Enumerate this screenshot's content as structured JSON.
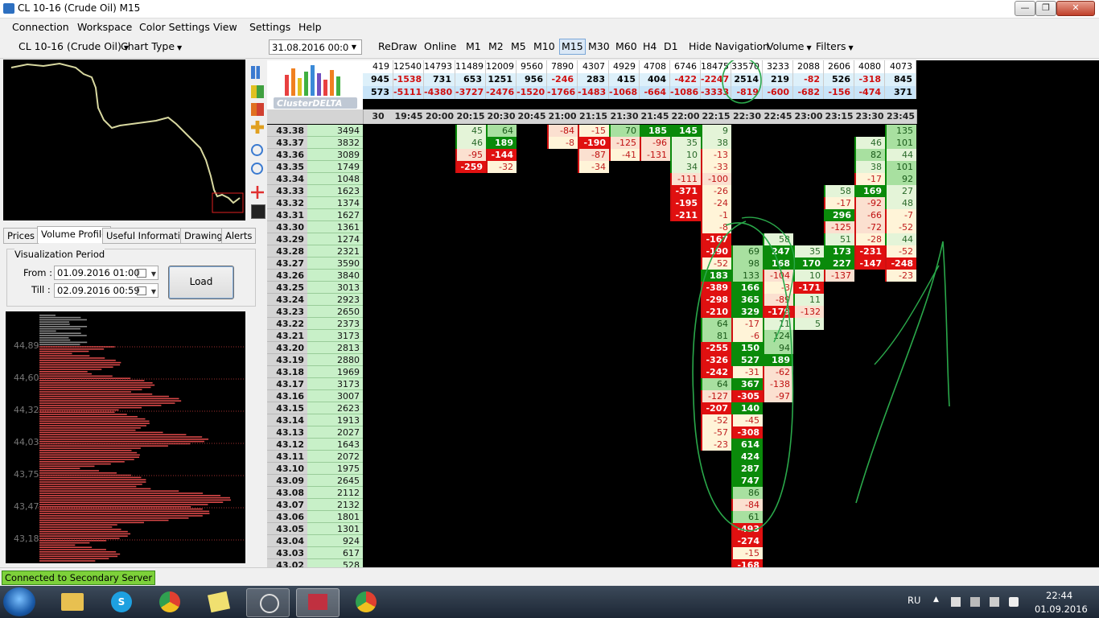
{
  "window": {
    "title": "CL 10-16 (Crude Oil) M15",
    "min": "—",
    "max": "❐",
    "close": "✕"
  },
  "menu": [
    "Connection",
    "Workspace",
    "Color Settings",
    "View",
    "Settings",
    "Help"
  ],
  "toolbar": {
    "instrument": "CL 10-16 (Crude Oil)",
    "chart_type": "Chart Type",
    "date": "31.08.2016 00:0",
    "redraw": "ReDraw",
    "online": "Online",
    "timeframes": [
      "M1",
      "M5",
      "M10",
      "M15",
      "M30",
      "M60",
      "H4",
      "D1"
    ],
    "active_timeframe": "M15",
    "timeframe_labels": {
      "m1": "M1",
      "m2": "M2",
      "m5": "M5",
      "m10": "M10",
      "m15": "M15",
      "m30": "M30",
      "m60": "M60",
      "h4": "H4",
      "d1": "D1"
    },
    "hide_navigation": "Hide Navigation",
    "volume": "Volume",
    "filters": "Filters"
  },
  "left_panel": {
    "tabs": [
      "Prices",
      "Volume Profile",
      "Useful Information",
      "Drawing",
      "Alerts"
    ],
    "active_tab": "Volume Profile",
    "viz_period_label": "Visualization Period",
    "from_label": "From :",
    "from_value": "01.09.2016 01:00",
    "till_label": "Till :",
    "till_value": "02.09.2016 00:59",
    "load_button": "Load",
    "profile_levels": [
      "44,89",
      "44,60",
      "44,32",
      "44,03",
      "43,75",
      "43,47",
      "43,18"
    ]
  },
  "logo_text": "ClusterDELTA",
  "grid": {
    "summary_rows": [
      [
        "419",
        "12540",
        "14793",
        "11489",
        "12009",
        "9560",
        "7890",
        "4307",
        "4929",
        "4708",
        "6746",
        "18475",
        "33570",
        "3233",
        "2088",
        "2606",
        "4080",
        "4073"
      ],
      [
        "945",
        "-1538",
        "731",
        "653",
        "1251",
        "956",
        "-246",
        "283",
        "415",
        "404",
        "-422",
        "-2247",
        "2514",
        "219",
        "-82",
        "526",
        "-318",
        "845"
      ],
      [
        "573",
        "-5111",
        "-4380",
        "-3727",
        "-2476",
        "-1520",
        "-1766",
        "-1483",
        "-1068",
        "-664",
        "-1086",
        "-3333",
        "-819",
        "-600",
        "-682",
        "-156",
        "-474",
        "371"
      ]
    ],
    "times": [
      "30",
      "19:45",
      "20:00",
      "20:15",
      "20:30",
      "20:45",
      "21:00",
      "21:15",
      "21:30",
      "21:45",
      "22:00",
      "22:15",
      "22:30",
      "22:45",
      "23:00",
      "23:15",
      "23:30",
      "23:45"
    ],
    "prices": [
      "43.38",
      "43.37",
      "43.36",
      "43.35",
      "43.34",
      "43.33",
      "43.32",
      "43.31",
      "43.30",
      "43.29",
      "43.28",
      "43.27",
      "43.26",
      "43.25",
      "43.24",
      "43.23",
      "43.22",
      "43.21",
      "43.20",
      "43.19",
      "43.18",
      "43.17",
      "43.16",
      "43.15",
      "43.14",
      "43.13",
      "43.12",
      "43.11",
      "43.10",
      "43.09",
      "43.08",
      "43.07",
      "43.06",
      "43.05",
      "43.04",
      "43.03",
      "43.02"
    ],
    "price_volumes": [
      "3494",
      "3832",
      "3089",
      "1749",
      "1048",
      "1623",
      "1374",
      "1627",
      "1361",
      "1274",
      "2321",
      "3590",
      "3840",
      "3013",
      "2923",
      "2650",
      "2373",
      "3173",
      "2813",
      "2880",
      "1969",
      "3173",
      "3007",
      "2623",
      "1913",
      "2027",
      "1643",
      "2072",
      "1975",
      "2645",
      "2112",
      "2132",
      "1801",
      "1301",
      "924",
      "617",
      "528"
    ],
    "cells": [
      {
        "c": 3,
        "r": 0,
        "v": "45"
      },
      {
        "c": 4,
        "r": 0,
        "v": "64"
      },
      {
        "c": 6,
        "r": 0,
        "v": "-84"
      },
      {
        "c": 7,
        "r": 0,
        "v": "-15"
      },
      {
        "c": 8,
        "r": 0,
        "v": "70"
      },
      {
        "c": 9,
        "r": 0,
        "v": "185"
      },
      {
        "c": 10,
        "r": 0,
        "v": "145"
      },
      {
        "c": 11,
        "r": 0,
        "v": "9"
      },
      {
        "c": 17,
        "r": 0,
        "v": "135"
      },
      {
        "c": 3,
        "r": 1,
        "v": "46"
      },
      {
        "c": 4,
        "r": 1,
        "v": "189"
      },
      {
        "c": 6,
        "r": 1,
        "v": "-8"
      },
      {
        "c": 7,
        "r": 1,
        "v": "-190"
      },
      {
        "c": 8,
        "r": 1,
        "v": "-125"
      },
      {
        "c": 9,
        "r": 1,
        "v": "-96"
      },
      {
        "c": 10,
        "r": 1,
        "v": "35"
      },
      {
        "c": 11,
        "r": 1,
        "v": "38"
      },
      {
        "c": 16,
        "r": 1,
        "v": "46"
      },
      {
        "c": 17,
        "r": 1,
        "v": "101"
      },
      {
        "c": 3,
        "r": 2,
        "v": "-95"
      },
      {
        "c": 4,
        "r": 2,
        "v": "-144"
      },
      {
        "c": 7,
        "r": 2,
        "v": "-87"
      },
      {
        "c": 8,
        "r": 2,
        "v": "-41"
      },
      {
        "c": 9,
        "r": 2,
        "v": "-131"
      },
      {
        "c": 10,
        "r": 2,
        "v": "10"
      },
      {
        "c": 11,
        "r": 2,
        "v": "-13"
      },
      {
        "c": 16,
        "r": 2,
        "v": "82"
      },
      {
        "c": 17,
        "r": 2,
        "v": "44"
      },
      {
        "c": 3,
        "r": 3,
        "v": "-259"
      },
      {
        "c": 4,
        "r": 3,
        "v": "-32"
      },
      {
        "c": 7,
        "r": 3,
        "v": "-34"
      },
      {
        "c": 10,
        "r": 3,
        "v": "34"
      },
      {
        "c": 11,
        "r": 3,
        "v": "-33"
      },
      {
        "c": 16,
        "r": 3,
        "v": "38"
      },
      {
        "c": 17,
        "r": 3,
        "v": "101"
      },
      {
        "c": 10,
        "r": 4,
        "v": "-111"
      },
      {
        "c": 11,
        "r": 4,
        "v": "-100"
      },
      {
        "c": 16,
        "r": 4,
        "v": "-17"
      },
      {
        "c": 17,
        "r": 4,
        "v": "92"
      },
      {
        "c": 10,
        "r": 5,
        "v": "-371"
      },
      {
        "c": 11,
        "r": 5,
        "v": "-26"
      },
      {
        "c": 15,
        "r": 5,
        "v": "58"
      },
      {
        "c": 16,
        "r": 5,
        "v": "169"
      },
      {
        "c": 17,
        "r": 5,
        "v": "27"
      },
      {
        "c": 10,
        "r": 6,
        "v": "-195"
      },
      {
        "c": 11,
        "r": 6,
        "v": "-24"
      },
      {
        "c": 15,
        "r": 6,
        "v": "-17"
      },
      {
        "c": 16,
        "r": 6,
        "v": "-92"
      },
      {
        "c": 17,
        "r": 6,
        "v": "48"
      },
      {
        "c": 10,
        "r": 7,
        "v": "-211"
      },
      {
        "c": 11,
        "r": 7,
        "v": "-1"
      },
      {
        "c": 15,
        "r": 7,
        "v": "296"
      },
      {
        "c": 16,
        "r": 7,
        "v": "-66"
      },
      {
        "c": 17,
        "r": 7,
        "v": "-7"
      },
      {
        "c": 11,
        "r": 8,
        "v": "-8"
      },
      {
        "c": 15,
        "r": 8,
        "v": "-125"
      },
      {
        "c": 16,
        "r": 8,
        "v": "-72"
      },
      {
        "c": 17,
        "r": 8,
        "v": "-52"
      },
      {
        "c": 11,
        "r": 9,
        "v": "-167"
      },
      {
        "c": 13,
        "r": 9,
        "v": "58"
      },
      {
        "c": 15,
        "r": 9,
        "v": "51"
      },
      {
        "c": 16,
        "r": 9,
        "v": "-28"
      },
      {
        "c": 17,
        "r": 9,
        "v": "44"
      },
      {
        "c": 11,
        "r": 10,
        "v": "-190"
      },
      {
        "c": 12,
        "r": 10,
        "v": "69"
      },
      {
        "c": 13,
        "r": 10,
        "v": "247"
      },
      {
        "c": 14,
        "r": 10,
        "v": "35"
      },
      {
        "c": 15,
        "r": 10,
        "v": "173"
      },
      {
        "c": 16,
        "r": 10,
        "v": "-231"
      },
      {
        "c": 17,
        "r": 10,
        "v": "-52"
      },
      {
        "c": 11,
        "r": 11,
        "v": "-52"
      },
      {
        "c": 12,
        "r": 11,
        "v": "98"
      },
      {
        "c": 13,
        "r": 11,
        "v": "168"
      },
      {
        "c": 14,
        "r": 11,
        "v": "170"
      },
      {
        "c": 15,
        "r": 11,
        "v": "227"
      },
      {
        "c": 16,
        "r": 11,
        "v": "-147"
      },
      {
        "c": 17,
        "r": 11,
        "v": "-248"
      },
      {
        "c": 11,
        "r": 12,
        "v": "183"
      },
      {
        "c": 12,
        "r": 12,
        "v": "133"
      },
      {
        "c": 13,
        "r": 12,
        "v": "-104"
      },
      {
        "c": 14,
        "r": 12,
        "v": "10"
      },
      {
        "c": 15,
        "r": 12,
        "v": "-137"
      },
      {
        "c": 17,
        "r": 12,
        "v": "-23"
      },
      {
        "c": 11,
        "r": 13,
        "v": "-389"
      },
      {
        "c": 12,
        "r": 13,
        "v": "166"
      },
      {
        "c": 13,
        "r": 13,
        "v": "-3"
      },
      {
        "c": 14,
        "r": 13,
        "v": "-171"
      },
      {
        "c": 11,
        "r": 14,
        "v": "-298"
      },
      {
        "c": 12,
        "r": 14,
        "v": "365"
      },
      {
        "c": 13,
        "r": 14,
        "v": "-89"
      },
      {
        "c": 14,
        "r": 14,
        "v": "11"
      },
      {
        "c": 11,
        "r": 15,
        "v": "-210"
      },
      {
        "c": 12,
        "r": 15,
        "v": "329"
      },
      {
        "c": 13,
        "r": 15,
        "v": "-179"
      },
      {
        "c": 14,
        "r": 15,
        "v": "-132"
      },
      {
        "c": 11,
        "r": 16,
        "v": "64"
      },
      {
        "c": 12,
        "r": 16,
        "v": "-17"
      },
      {
        "c": 13,
        "r": 16,
        "v": "11"
      },
      {
        "c": 14,
        "r": 16,
        "v": "5"
      },
      {
        "c": 11,
        "r": 17,
        "v": "81"
      },
      {
        "c": 12,
        "r": 17,
        "v": "-6"
      },
      {
        "c": 13,
        "r": 17,
        "v": "124"
      },
      {
        "c": 11,
        "r": 18,
        "v": "-255"
      },
      {
        "c": 12,
        "r": 18,
        "v": "150"
      },
      {
        "c": 13,
        "r": 18,
        "v": "94"
      },
      {
        "c": 11,
        "r": 19,
        "v": "-326"
      },
      {
        "c": 12,
        "r": 19,
        "v": "527"
      },
      {
        "c": 13,
        "r": 19,
        "v": "189"
      },
      {
        "c": 11,
        "r": 20,
        "v": "-242"
      },
      {
        "c": 12,
        "r": 20,
        "v": "-31"
      },
      {
        "c": 13,
        "r": 20,
        "v": "-62"
      },
      {
        "c": 11,
        "r": 21,
        "v": "64"
      },
      {
        "c": 12,
        "r": 21,
        "v": "367"
      },
      {
        "c": 13,
        "r": 21,
        "v": "-138"
      },
      {
        "c": 11,
        "r": 22,
        "v": "-127"
      },
      {
        "c": 12,
        "r": 22,
        "v": "-305"
      },
      {
        "c": 13,
        "r": 22,
        "v": "-97"
      },
      {
        "c": 11,
        "r": 23,
        "v": "-207"
      },
      {
        "c": 12,
        "r": 23,
        "v": "140"
      },
      {
        "c": 11,
        "r": 24,
        "v": "-52"
      },
      {
        "c": 12,
        "r": 24,
        "v": "-45"
      },
      {
        "c": 11,
        "r": 25,
        "v": "-57"
      },
      {
        "c": 12,
        "r": 25,
        "v": "-308"
      },
      {
        "c": 11,
        "r": 26,
        "v": "-23"
      },
      {
        "c": 12,
        "r": 26,
        "v": "614"
      },
      {
        "c": 12,
        "r": 27,
        "v": "424"
      },
      {
        "c": 12,
        "r": 28,
        "v": "287"
      },
      {
        "c": 12,
        "r": 29,
        "v": "747"
      },
      {
        "c": 12,
        "r": 30,
        "v": "86"
      },
      {
        "c": 12,
        "r": 31,
        "v": "-84"
      },
      {
        "c": 12,
        "r": 32,
        "v": "61"
      },
      {
        "c": 12,
        "r": 33,
        "v": "-493"
      },
      {
        "c": 12,
        "r": 34,
        "v": "-274"
      },
      {
        "c": 12,
        "r": 35,
        "v": "-15"
      },
      {
        "c": 12,
        "r": 36,
        "v": "-168"
      }
    ]
  },
  "status": "Connected to Secondary Server",
  "taskbar": {
    "lang": "RU",
    "time": "22:44",
    "date": "01.09.2016"
  },
  "colors": {
    "strong_green": "#0a8a0a",
    "mid_green": "#a8e0a0",
    "light_green": "#e4f4d8",
    "light_red": "#fbe0d0",
    "mid_red": "#f0a080",
    "strong_red": "#e01010",
    "cream": "#fff4d8",
    "annotation": "#2aa84a"
  }
}
